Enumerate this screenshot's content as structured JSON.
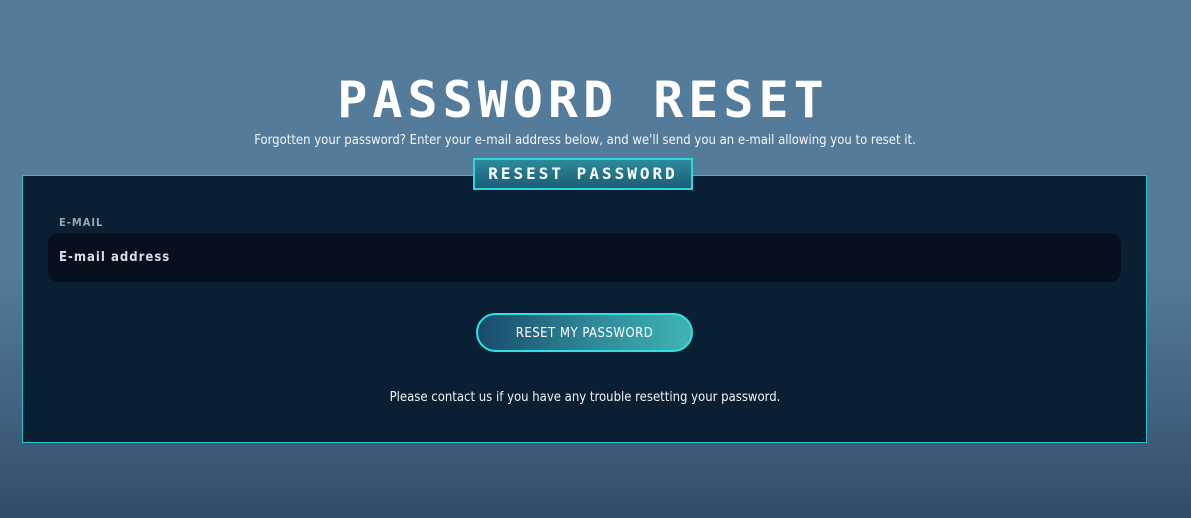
{
  "header": {
    "title": "PASSWORD RESET",
    "subtitle": "Forgotten your password? Enter your e-mail address below, and we'll send you an e-mail allowing you to reset it."
  },
  "card": {
    "tag": "RESEST PASSWORD",
    "email": {
      "label": "E-MAIL",
      "placeholder": "E-mail address",
      "value": ""
    },
    "submit_label": "RESET MY PASSWORD",
    "help_text": "Please contact us if you have any trouble resetting your password."
  },
  "colors": {
    "accent": "#2fd7dc",
    "card_background": "#0a1f33",
    "page_background": "#557b9b",
    "input_background": "#060f1b"
  }
}
